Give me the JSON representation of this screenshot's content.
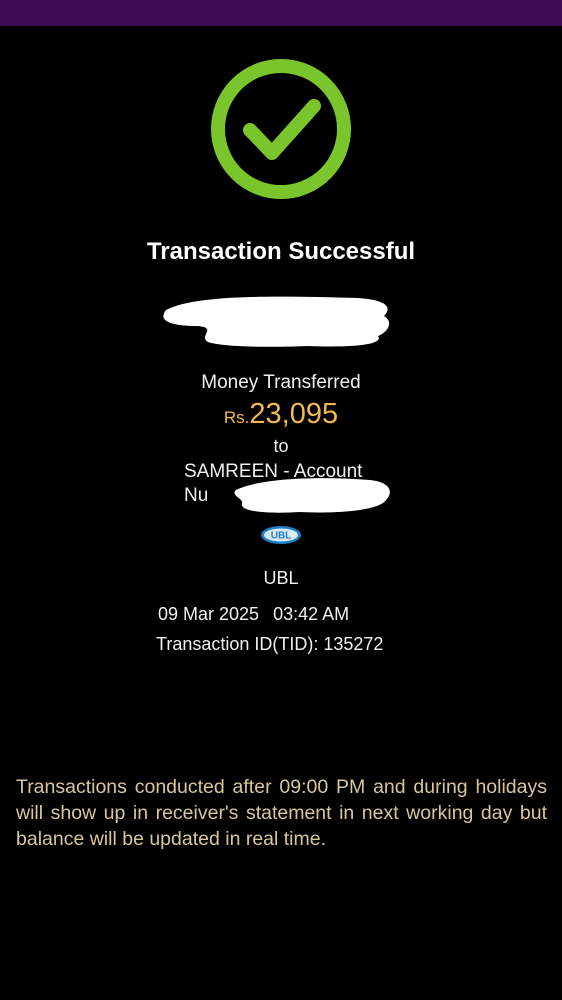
{
  "header": {
    "bar_color": "#3d0b52"
  },
  "status": {
    "icon": "check-circle-icon",
    "icon_color": "#7ac52c",
    "title": "Transaction Successful"
  },
  "transfer": {
    "label": "Money Transferred",
    "currency": "Rs.",
    "amount": "23,095",
    "to_label": "to",
    "recipient_line1": "SAMREEN  - Account",
    "recipient_line2_prefix": "Nu"
  },
  "bank": {
    "logo_text": "UBL",
    "name": "UBL"
  },
  "details": {
    "date": "09 Mar 2025",
    "time": "03:42 AM",
    "transaction_id": "Transaction ID(TID): 135272"
  },
  "disclaimer": "Transactions conducted after 09:00 PM and during holidays will show up in receiver's statement in next working day but balance will be updated in real time."
}
